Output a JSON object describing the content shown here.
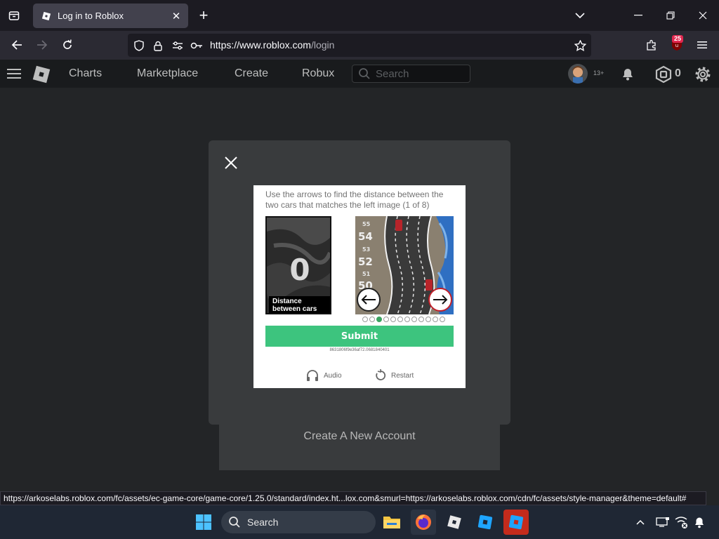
{
  "browser": {
    "tab_title": "Log in to Roblox",
    "url_host": "https://www.roblox.com",
    "url_path": "/login",
    "extension_badge": "25",
    "status_url": "https://arkoselabs.roblox.com/fc/assets/ec-game-core/game-core/1.25.0/standard/index.ht...lox.com&smurl=https://arkoselabs.roblox.com/cdn/fc/assets/style-manager&theme=default#"
  },
  "roblox_header": {
    "nav": [
      "Charts",
      "Marketplace",
      "Create",
      "Robux"
    ],
    "search_placeholder": "Search",
    "age_badge": "13+",
    "robux_count": "0"
  },
  "page": {
    "create_account_label": "Create A New Account"
  },
  "captcha": {
    "instruction": "Use the arrows to find the distance between the two cars that matches the left image (1 of 8)",
    "left_image_value": "0",
    "left_image_label": "Distance between cars",
    "road_markers": [
      "55",
      "54",
      "53",
      "52",
      "51",
      "50"
    ],
    "progress": {
      "total": 12,
      "current": 3
    },
    "submit_label": "Submit",
    "session_id": "8631806f9e36af72.0681840401",
    "audio_label": "Audio",
    "restart_label": "Restart"
  },
  "taskbar": {
    "search_placeholder": "Search"
  },
  "colors": {
    "submit_green": "#3dc47e",
    "modal_bg": "#393b3d",
    "page_bg": "#232527",
    "header_bg": "#191b1d"
  }
}
